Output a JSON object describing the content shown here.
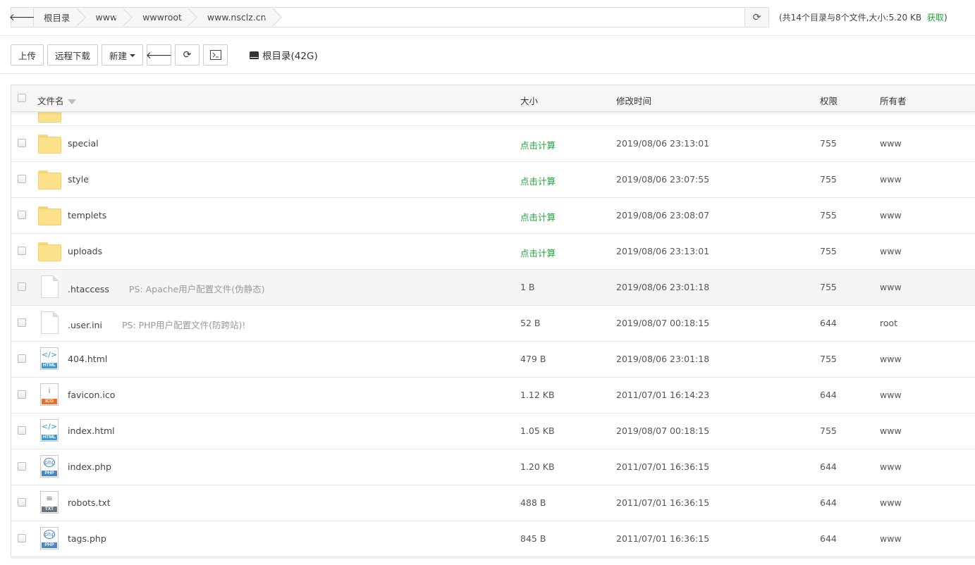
{
  "breadcrumb": {
    "back_icon": "arrow-left-icon",
    "items": [
      "根目录",
      "www",
      "wwwroot",
      "www.nsclz.cn"
    ],
    "refresh_icon": "refresh-icon"
  },
  "summary": {
    "text": "(共14个目录与8个文件,大小:5.20 KB",
    "link": "获取",
    "close": ")"
  },
  "toolbar": {
    "upload": "上传",
    "remote_download": "远程下载",
    "new": "新建",
    "disk_label": "根目录(42G)"
  },
  "table": {
    "headers": {
      "name": "文件名",
      "size": "大小",
      "mtime": "修改时间",
      "perm": "权限",
      "owner": "所有者"
    },
    "rows": [
      {
        "type": "folder",
        "name": "special",
        "ps": "",
        "size": "点击计算",
        "mtime": "2019/08/06 23:13:01",
        "perm": "755",
        "owner": "www"
      },
      {
        "type": "folder",
        "name": "style",
        "ps": "",
        "size": "点击计算",
        "mtime": "2019/08/06 23:07:55",
        "perm": "755",
        "owner": "www"
      },
      {
        "type": "folder",
        "name": "templets",
        "ps": "",
        "size": "点击计算",
        "mtime": "2019/08/06 23:08:07",
        "perm": "755",
        "owner": "www"
      },
      {
        "type": "folder",
        "name": "uploads",
        "ps": "",
        "size": "点击计算",
        "mtime": "2019/08/06 23:13:01",
        "perm": "755",
        "owner": "www"
      },
      {
        "type": "doc",
        "name": ".htaccess",
        "ps": "PS: Apache用户配置文件(伪静态)",
        "size": "1 B",
        "mtime": "2019/08/06 23:01:18",
        "perm": "755",
        "owner": "www"
      },
      {
        "type": "doc",
        "name": ".user.ini",
        "ps": "PS: PHP用户配置文件(防跨站)!",
        "size": "52 B",
        "mtime": "2019/08/07 00:18:15",
        "perm": "644",
        "owner": "root"
      },
      {
        "type": "html",
        "name": "404.html",
        "ps": "",
        "size": "479 B",
        "mtime": "2019/08/06 23:01:18",
        "perm": "755",
        "owner": "www"
      },
      {
        "type": "ico",
        "name": "favicon.ico",
        "ps": "",
        "size": "1.12 KB",
        "mtime": "2011/07/01 16:14:23",
        "perm": "644",
        "owner": "www"
      },
      {
        "type": "html",
        "name": "index.html",
        "ps": "",
        "size": "1.05 KB",
        "mtime": "2019/08/07 00:18:15",
        "perm": "755",
        "owner": "www"
      },
      {
        "type": "php",
        "name": "index.php",
        "ps": "",
        "size": "1.20 KB",
        "mtime": "2011/07/01 16:36:15",
        "perm": "644",
        "owner": "www"
      },
      {
        "type": "txt",
        "name": "robots.txt",
        "ps": "",
        "size": "488 B",
        "mtime": "2011/07/01 16:36:15",
        "perm": "644",
        "owner": "www"
      },
      {
        "type": "php",
        "name": "tags.php",
        "ps": "",
        "size": "845 B",
        "mtime": "2011/07/01 16:36:15",
        "perm": "644",
        "owner": "www"
      }
    ]
  },
  "file_icons": {
    "html": {
      "glyph": "</>",
      "label": "HTML",
      "color": "#3a9bd1"
    },
    "ico": {
      "glyph": "i",
      "label": "ICO",
      "color": "#e8712b"
    },
    "php": {
      "glyph": "php",
      "label": "PHP",
      "color": "#4a87c7"
    },
    "txt": {
      "glyph": "≡",
      "label": "TXT",
      "color": "#6b7280"
    }
  },
  "colors": {
    "accent_green": "#20a53a",
    "folder_yellow": "#fde08a"
  }
}
